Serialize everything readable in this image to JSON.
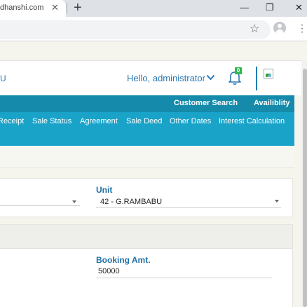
{
  "browser": {
    "tab_title": "dhanshi.com",
    "close_glyph": "✕",
    "new_tab_glyph": "+",
    "minimize_glyph": "—",
    "restore_glyph": "❐",
    "star_glyph": "☆",
    "menu_glyph": "⋮"
  },
  "header": {
    "brand_fragment": "U",
    "greeting": "Hello, administrator",
    "notification_count": "0"
  },
  "nav_top": {
    "items": [
      "Customer Search",
      "Availiblity"
    ]
  },
  "nav_main": {
    "items": [
      "Receipt",
      "Sale Status",
      "Agreement",
      "Sale Deed",
      "Other Dates",
      "Interest Calculation"
    ]
  },
  "form": {
    "unit_label": "Unit",
    "unit_value": "42 - G.RAMBABU",
    "booking_amount_label": "Booking Amt.",
    "booking_amount_value": "50000"
  },
  "colors": {
    "nav_dark": "#158aaa",
    "nav_light": "#1aa3c8",
    "label_blue": "#1f6fa8",
    "badge_green": "#2fb84a"
  }
}
